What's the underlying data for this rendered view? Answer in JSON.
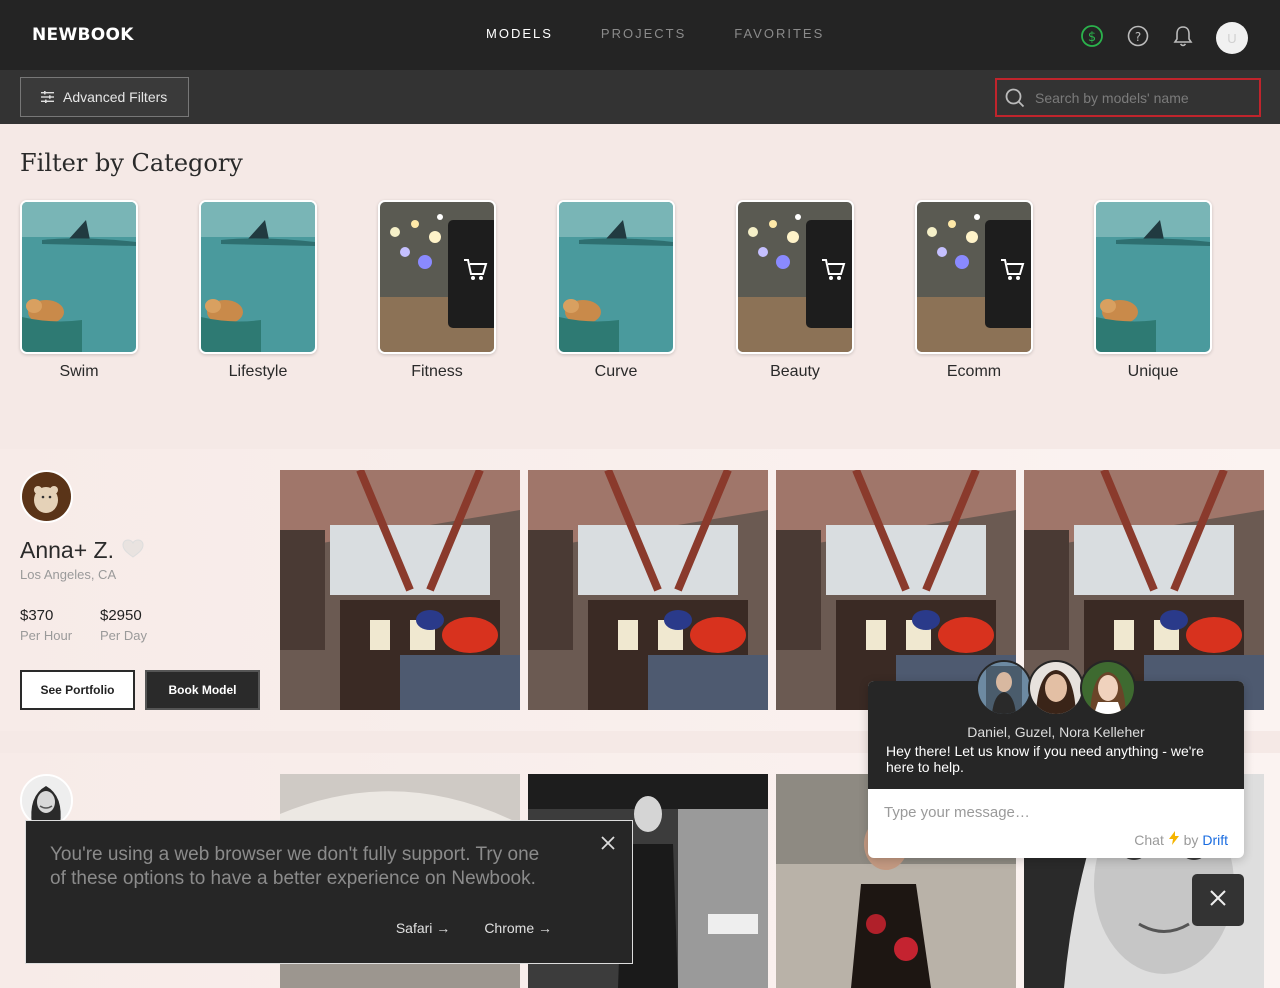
{
  "header": {
    "logo": "NEWBOOK",
    "nav": [
      "MODELS",
      "PROJECTS",
      "FAVORITES"
    ],
    "active_nav": "MODELS",
    "avatar_initial": "U",
    "icons": [
      "dollar-circle-icon",
      "help-icon",
      "bell-icon"
    ],
    "accent_green": "#2bb24c"
  },
  "filterbar": {
    "advanced_filters_label": "Advanced Filters",
    "search_placeholder": "Search by models' name",
    "search_border_color": "#c0242c"
  },
  "category": {
    "title": "Filter by Category",
    "items": [
      {
        "label": "Swim",
        "image": "swimming-dog"
      },
      {
        "label": "Lifestyle",
        "image": "swimming-dog"
      },
      {
        "label": "Fitness",
        "image": "shopping-phone"
      },
      {
        "label": "Curve",
        "image": "swimming-dog"
      },
      {
        "label": "Beauty",
        "image": "shopping-phone"
      },
      {
        "label": "Ecomm",
        "image": "shopping-phone"
      },
      {
        "label": "Unique",
        "image": "swimming-dog"
      }
    ]
  },
  "models": [
    {
      "name": "Anna+ Z.",
      "location": "Los Angeles, CA",
      "rate_hour": "$370",
      "rate_hour_label": "Per Hour",
      "rate_day": "$2950",
      "rate_day_label": "Per Day",
      "see_portfolio_label": "See Portfolio",
      "book_label": "Book Model"
    }
  ],
  "browser_warning": {
    "text": "You're using a web browser we don't fully support. Try one of these options to have a better experience on Newbook.",
    "links": [
      "Safari →",
      "Chrome →"
    ]
  },
  "chat": {
    "agents": "Daniel, Guzel, Nora Kelleher",
    "message": "Hey there! Let us know if you need anything - we're here to help.",
    "input_placeholder": "Type your message…",
    "brand_prefix": "Chat",
    "brand_by": "by",
    "brand_name": "Drift"
  }
}
